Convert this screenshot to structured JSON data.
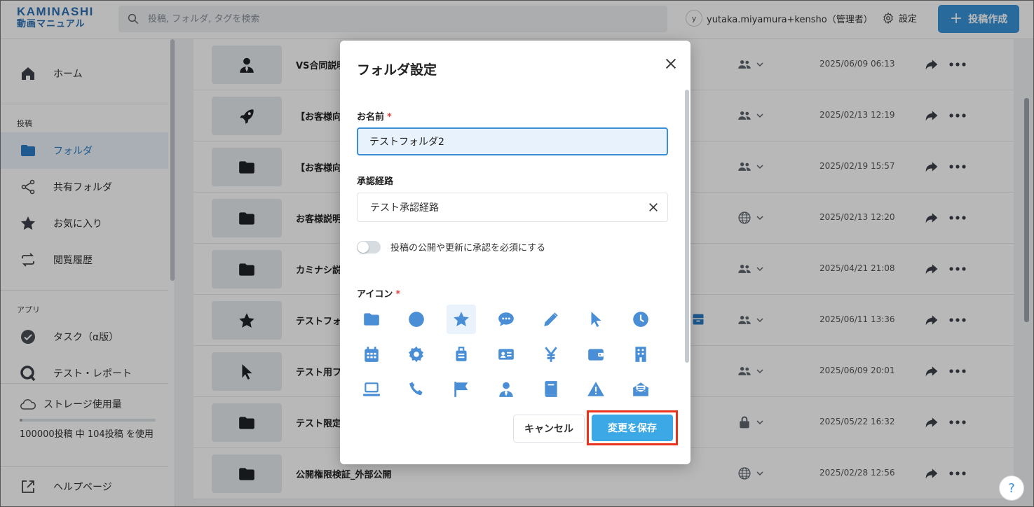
{
  "app": {
    "logo_line1": "KAMINASHI",
    "logo_line2": "動画マニュアル"
  },
  "header": {
    "search_placeholder": "投稿, フォルダ, タグを検索",
    "user_initial": "y",
    "user_name": "yutaka.miyamura+kensho（管理者）",
    "settings_label": "設定",
    "create_label": "投稿作成"
  },
  "sidebar": {
    "home": "ホーム",
    "section_posts": "投稿",
    "folders": "フォルダ",
    "shared_folders": "共有フォルダ",
    "favorites": "お気に入り",
    "history": "閲覧履歴",
    "section_apps": "アプリ",
    "tasks": "タスク（α版）",
    "test_report": "テスト・レポート",
    "storage_title": "ストレージ使用量",
    "storage_usage": "100000投稿 中 104投稿 を使用",
    "storage_fraction": 0.00104,
    "help_page": "ヘルプページ"
  },
  "rows": [
    {
      "icon": "user-icon",
      "name": "VS合同説明",
      "visibility": "group-icon",
      "date": "2025/06/09 06:13"
    },
    {
      "icon": "rocket-icon",
      "name": "【お客様向",
      "visibility": "group-icon",
      "date": "2025/02/13 12:19"
    },
    {
      "icon": "folder-icon",
      "name": "【お客様向",
      "visibility": "group-icon",
      "date": "2025/02/19 15:57"
    },
    {
      "icon": "folder-icon",
      "name": "お客様説明",
      "visibility": "globe-icon",
      "date": "2025/02/13 12:20"
    },
    {
      "icon": "folder-icon",
      "name": "カミナシ説",
      "visibility": "group-icon",
      "date": "2025/04/21 21:08"
    },
    {
      "icon": "star-icon",
      "name": "テストフォ",
      "visibility": "group-icon",
      "date": "2025/06/11 13:36"
    },
    {
      "icon": "cursor-icon",
      "name": "テスト用フ",
      "visibility": "group-icon",
      "date": "2025/06/09 20:01"
    },
    {
      "icon": "folder-icon",
      "name": "テスト限定",
      "visibility": "lock-icon",
      "date": "2025/05/22 16:32"
    },
    {
      "icon": "folder-icon",
      "name": "公開権限検証_外部公開",
      "visibility": "globe-icon",
      "date": "2025/02/28 12:56"
    }
  ],
  "modal": {
    "title": "フォルダ設定",
    "name_label": "お名前",
    "name_value": "テストフォルダ2",
    "required_mark": "*",
    "route_label": "承認経路",
    "route_value": "テスト承認経路",
    "toggle_label": "投稿の公開や更新に承認を必須にする",
    "toggle_on": false,
    "icon_label": "アイコン",
    "selected_icon": "star-icon",
    "icons": [
      "folder-icon",
      "circle-icon",
      "star-icon",
      "chat-icon",
      "pencil-icon",
      "cursor-icon",
      "clock-icon",
      "calendar-icon",
      "gear-icon",
      "luggage-icon",
      "id-card-icon",
      "yen-icon",
      "wallet-icon",
      "building-icon",
      "laptop-icon",
      "phone-icon",
      "flag-icon",
      "user-icon",
      "book-icon",
      "warning-icon",
      "mail-open-icon"
    ],
    "cancel_label": "キャンセル",
    "save_label": "変更を保存"
  },
  "colors": {
    "brand": "#2a6fb5",
    "primary_button": "#3a93d8",
    "active_nav": "#2a7cc7",
    "icon_blue": "#4a8fd6",
    "highlight_box": "#e8321c"
  },
  "help_label": "?"
}
